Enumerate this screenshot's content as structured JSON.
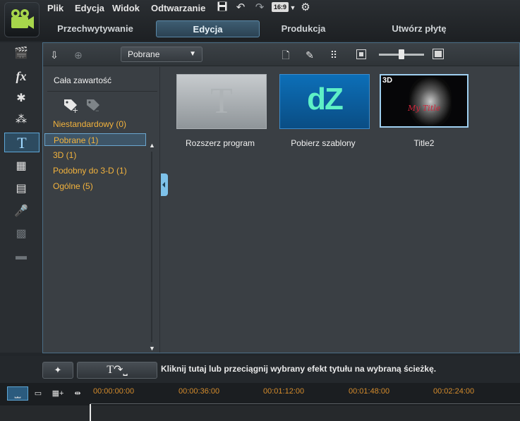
{
  "menu": {
    "items": [
      "Plik",
      "Edycja",
      "Widok",
      "Odtwarzanie"
    ],
    "aspect_ratio": "16:9"
  },
  "mode_tabs": [
    "Przechwytywanie",
    "Edycja",
    "Produkcja",
    "Utwórz płytę"
  ],
  "library": {
    "dropdown_value": "Pobrane",
    "categories_header": "Cała zawartość",
    "categories": [
      {
        "label": "Niestandardowy  (0)"
      },
      {
        "label": "Pobrane  (1)"
      },
      {
        "label": "3D  (1)"
      },
      {
        "label": "Podobny do 3-D  (1)"
      },
      {
        "label": "Ogólne  (5)"
      }
    ],
    "selected_category": "Pobrane  (1)",
    "thumbnails": [
      {
        "label": "Rozszerz program",
        "glyph": "T"
      },
      {
        "label": "Pobierz szablony",
        "glyph": "dZ"
      },
      {
        "label": "Title2",
        "badge": "3D",
        "caption": "My Title"
      }
    ]
  },
  "bottombar": {
    "hint": "Kliknij tutaj lub przeciągnij wybrany efekt tytułu na wybraną ścieżkę."
  },
  "timeline": {
    "ticks": [
      "00:00:00:00",
      "00:00:36:00",
      "00:01:12:00",
      "00:01:48:00",
      "00:02:24:00"
    ]
  },
  "colors": {
    "accent": "#5da7d8",
    "category_text": "#f3b33d",
    "timecode": "#d58c2c"
  }
}
